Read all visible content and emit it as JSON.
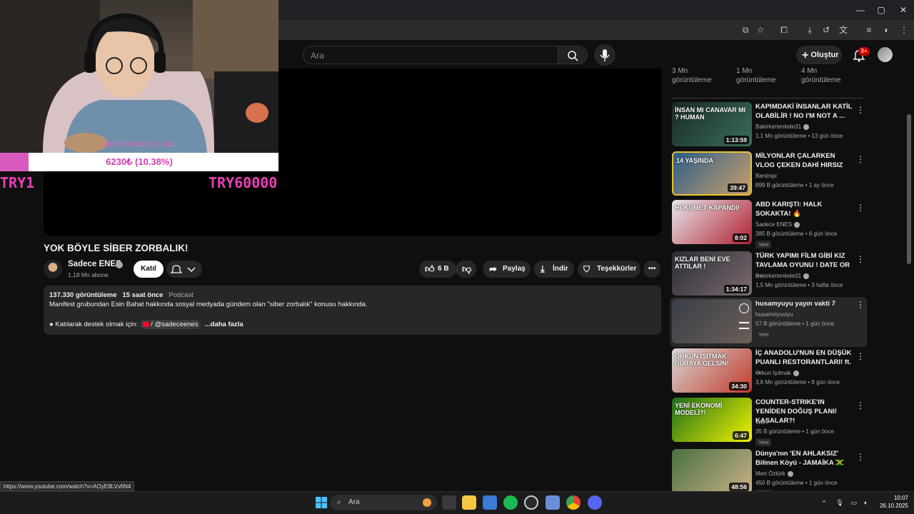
{
  "browser": {
    "window_controls": [
      "—",
      "▢",
      "✕"
    ]
  },
  "header": {
    "search_placeholder": "Ara",
    "create_label": "Oluştur",
    "notification_count": "9+"
  },
  "stream_overlay": {
    "caption": "alipnen desteği ) ǝlbu",
    "donation_progress_text": "6230₺ (10.38%)",
    "progress_fraction": 0.1038,
    "min_label": "TRY1",
    "max_label": "TRY60000"
  },
  "video": {
    "title": "YOK BÖYLE SİBER ZORBALIK!",
    "channel_name": "Sadece ENES",
    "subscribers": "1,18 Mn abone",
    "join_label": "Katıl",
    "likes": "6 B",
    "share_label": "Paylaş",
    "download_label": "İndir",
    "thanks_label": "Teşekkürler"
  },
  "description": {
    "views": "137.330 görüntüleme",
    "date": "15 saat önce",
    "tag": "Podcast",
    "line1": "Manifest grubundan Esin Bahat hakkında sosyal medyada gündem olan \"siber zorbalık\" konusu hakkında.",
    "line2_prefix": "● Katılarak destek olmak için:",
    "handle": "/ @sadeceenes",
    "more": "...daha fazla"
  },
  "sidebar": {
    "top_stats": [
      {
        "count": "3 Mn",
        "unit": "görüntüleme"
      },
      {
        "count": "1 Mn",
        "unit": "görüntüleme"
      },
      {
        "count": "4 Mn",
        "unit": "görüntüleme"
      }
    ],
    "recommendations": [
      {
        "title": "KAPIMDAKİ İNSANLAR KATİL OLABİLİR ! NO I'M NOT A ...",
        "channel": "Bakirkertenkele31",
        "meta": "1,1 Mn görüntüleme • 13 gün önce",
        "duration": "1:13:59",
        "new": "",
        "thumb_text": "İNSAN MI CANAVAR MI ? HUMAN",
        "colors": [
          "#1a2a25",
          "#3a6e5a"
        ]
      },
      {
        "title": "MİLYONLAR ÇALARKEN VLOG ÇEKEN DAHİ HIRSIZ",
        "channel": "Bentropi",
        "meta": "899 B görüntüleme • 1 ay önce",
        "duration": "39:47",
        "new": "",
        "thumb_text": "14 YAŞINDA",
        "colors": [
          "#2b5d8a",
          "#c9a06a"
        ]
      },
      {
        "title": "ABD KARIŞTI: HALK SOKAKTA! 🔥",
        "channel": "Sadece ENES",
        "meta": "385 B görüntüleme • 6 gün önce",
        "duration": "8:02",
        "new": "Yeni",
        "thumb_text": "HÜKÜMET KAPANDI!",
        "colors": [
          "#e8e8ee",
          "#b02030"
        ]
      },
      {
        "title": "TÜRK YAPIMI FİLM GİBİ KIZ TAVLAMA OYUNU ! DATE OR ...",
        "channel": "Bakirkertenkele31",
        "meta": "1,5 Mn görüntüleme • 3 hafta önce",
        "duration": "1:34:17",
        "new": "",
        "thumb_text": "KIZLAR BENİ EVE ATTILAR !",
        "colors": [
          "#2c2c34",
          "#7a6a70"
        ]
      },
      {
        "title": "husamyuyu yayın vakti 7",
        "channel": "husamviyuviyu",
        "meta": "57 B görüntüleme • 1 gün önce",
        "duration": "",
        "new": "Yeni",
        "thumb_text": "",
        "colors": [
          "#3a3f48",
          "#6a5e58"
        ]
      },
      {
        "title": "İÇ ANADOLU'NUN EN DÜŞÜK PUANLI RESTORANTLARI! ft. ...",
        "channel": "Orkun Işıtmak",
        "meta": "3,8 Mn görüntüleme • 8 gün önce",
        "duration": "34:30",
        "new": "",
        "thumb_text": "ORKUN IŞITMAK BURAYA GELSİN!",
        "colors": [
          "#d8d8d8",
          "#c03a2a"
        ]
      },
      {
        "title": "COUNTER-STRIKE'IN YENİDEN DOĞUŞ PLANI! KASALAR?!",
        "channel": "WaiT",
        "meta": "35 B görüntüleme • 1 gün önce",
        "duration": "6:47",
        "new": "Yeni",
        "thumb_text": "YENİ EKONOMİ MODELİ?!",
        "colors": [
          "#1b6e1b",
          "#f2f200"
        ]
      },
      {
        "title": "Dünya'nın 'EN AHLAKSIZ' Bilinen Köyü - JAMAİKA 🇯🇲",
        "channel": "Mert Öztürk",
        "meta": "450 B görüntüleme • 1 gün önce",
        "duration": "48:56",
        "new": "Yeni",
        "thumb_text": "",
        "colors": [
          "#4a7040",
          "#c8b088"
        ]
      }
    ]
  },
  "status_url": "https://www.youtube.com/watch?v=AOyE8LVv6N4",
  "taskbar": {
    "search_label": "Ara",
    "time": "10:07",
    "date": "26.10.2025"
  }
}
